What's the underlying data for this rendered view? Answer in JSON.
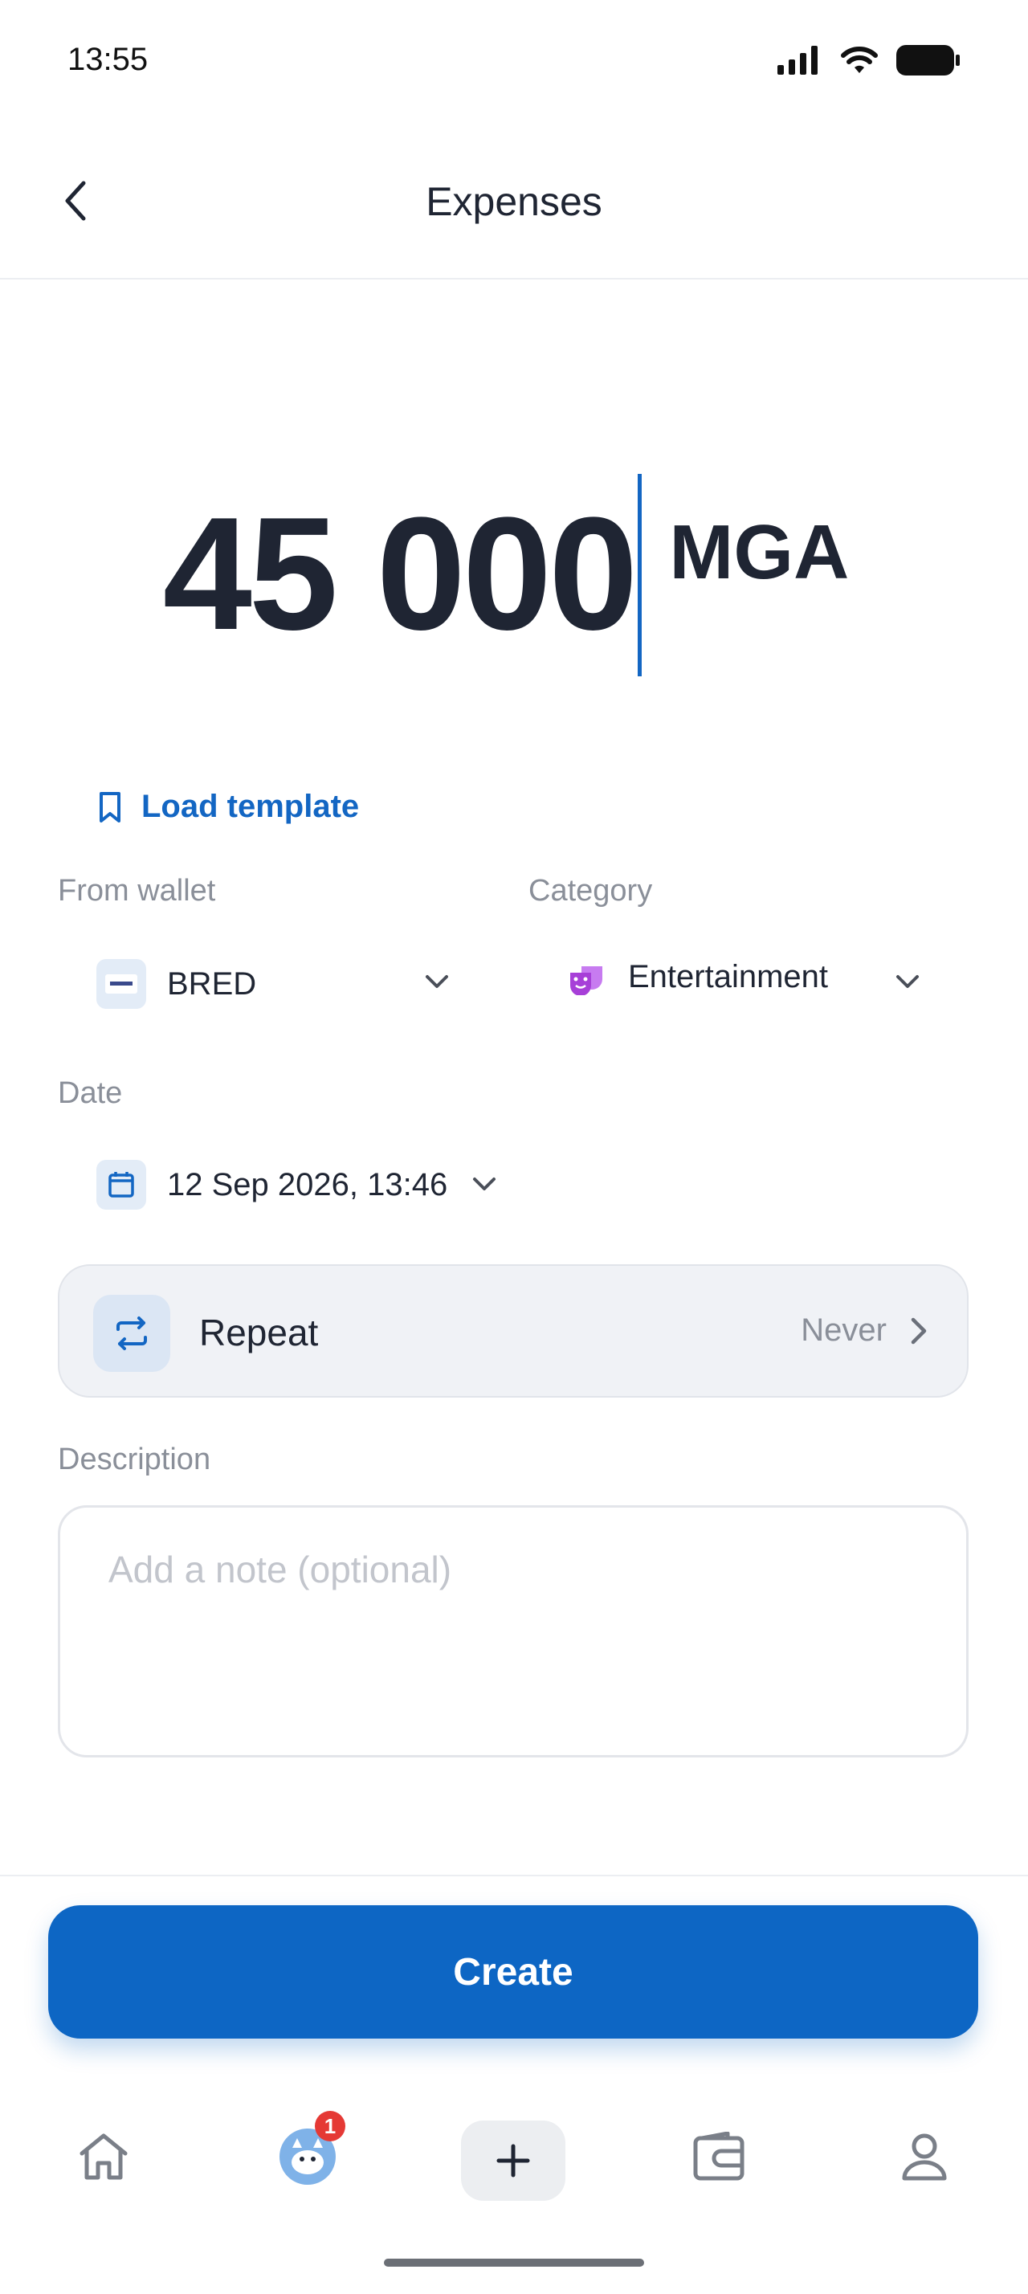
{
  "status_bar": {
    "time": "13:55"
  },
  "header": {
    "title": "Expenses"
  },
  "amount": {
    "value": "45 000",
    "currency": "MGA"
  },
  "load_template": {
    "label": "Load template"
  },
  "wallet": {
    "label": "From wallet",
    "value": "BRED",
    "logo_text": "BRED"
  },
  "category": {
    "label": "Category",
    "value": "Entertainment",
    "icon": "theater-masks-icon",
    "color": "#b04fd6"
  },
  "date": {
    "label": "Date",
    "value": "12 Sep 2026, 13:46"
  },
  "repeat": {
    "label": "Repeat",
    "value": "Never"
  },
  "description": {
    "label": "Description",
    "placeholder": "Add a note (optional)",
    "value": ""
  },
  "create_button": {
    "label": "Create"
  },
  "tabbar": {
    "items": [
      {
        "icon": "home-icon"
      },
      {
        "icon": "avatar-icon",
        "badge": "1"
      },
      {
        "icon": "plus-icon"
      },
      {
        "icon": "wallet-icon"
      },
      {
        "icon": "profile-icon"
      }
    ]
  },
  "colors": {
    "accent": "#0d66c4",
    "badge": "#e53935",
    "text": "#1f2533",
    "muted": "#8a8f99"
  }
}
